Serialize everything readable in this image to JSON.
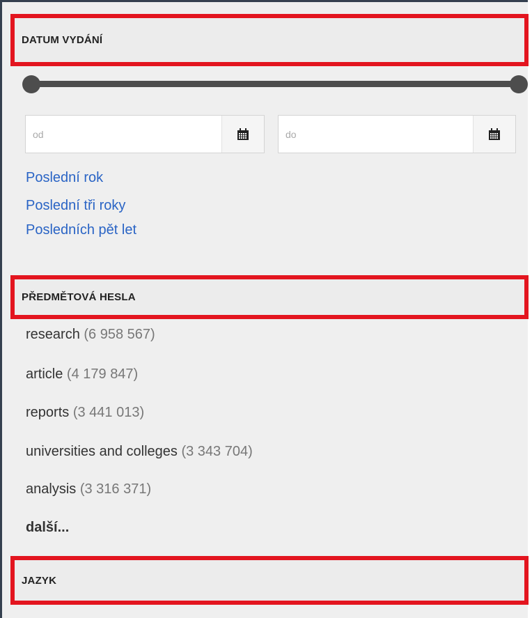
{
  "date_section": {
    "title": "DATUM VYDÁNÍ",
    "from_placeholder": "od",
    "to_placeholder": "do",
    "quick_links": [
      "Poslední rok",
      "Poslední tři roky",
      "Posledních pět let"
    ]
  },
  "subjects_section": {
    "title": "PŘEDMĚTOVÁ HESLA",
    "items": [
      {
        "label": "research",
        "count": "(6 958 567)"
      },
      {
        "label": "article",
        "count": "(4 179 847)"
      },
      {
        "label": "reports",
        "count": "(3 441 013)"
      },
      {
        "label": "universities and colleges",
        "count": "(3 343 704)"
      },
      {
        "label": "analysis",
        "count": "(3 316 371)"
      }
    ],
    "more_label": "další..."
  },
  "language_section": {
    "title": "JAZYK"
  },
  "icons": {
    "calendar": "calendar-icon"
  },
  "colors": {
    "highlight_border": "#e3151f",
    "link": "#2a64c5",
    "panel_bg": "#efefef"
  }
}
